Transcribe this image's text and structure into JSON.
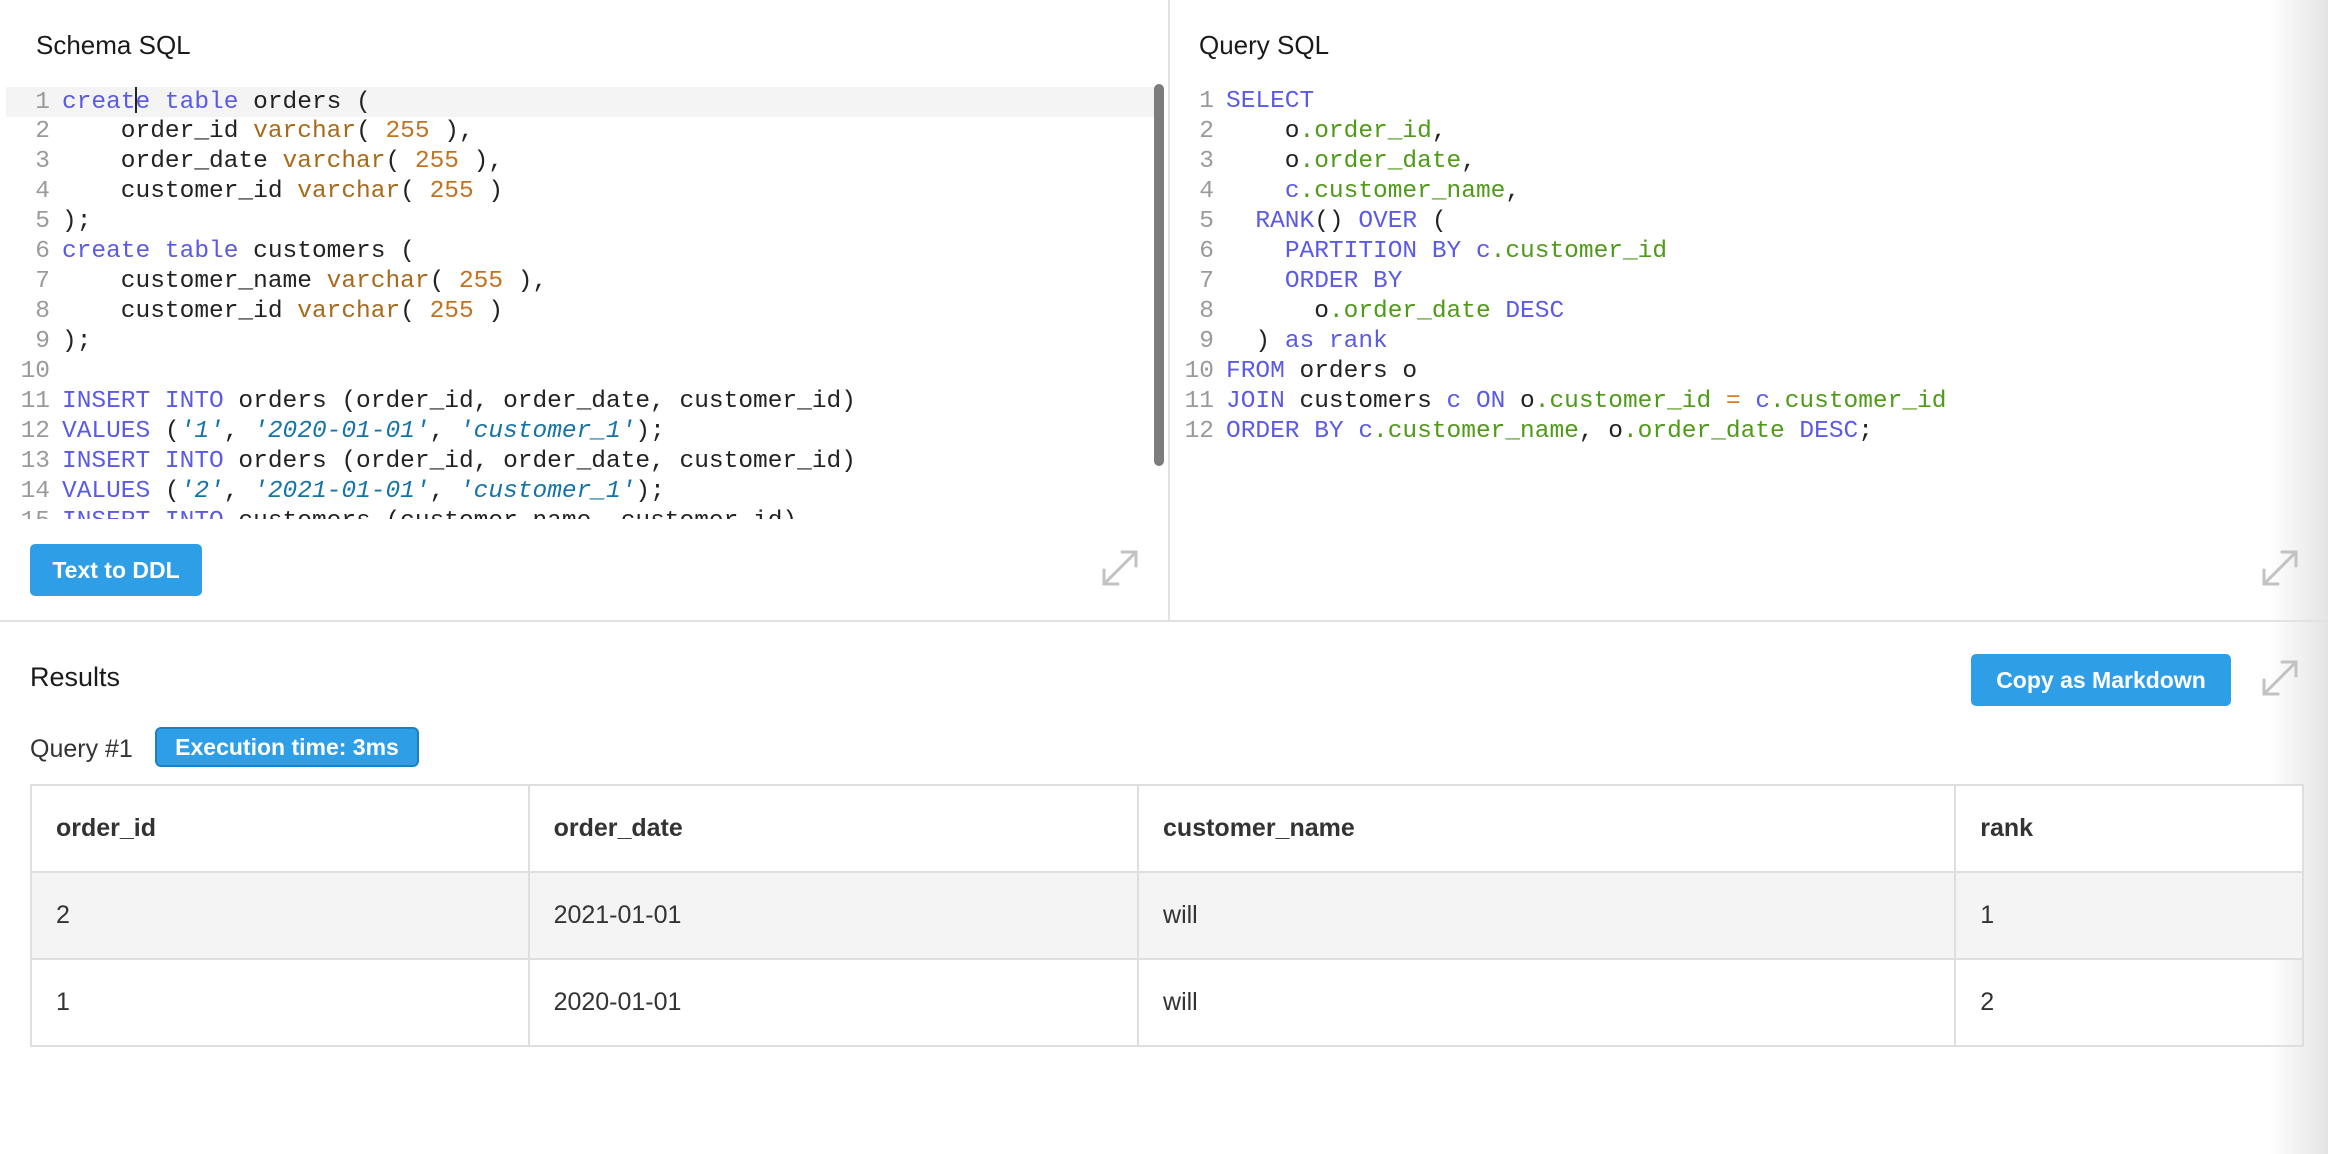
{
  "schema_panel": {
    "title": "Schema SQL",
    "button_label": "Text to DDL",
    "lines": [
      {
        "n": "1",
        "tokens": [
          [
            "kw",
            "creat"
          ],
          [
            "cursor",
            ""
          ],
          [
            "kw",
            "e"
          ],
          [
            "txt",
            " "
          ],
          [
            "kw",
            "table"
          ],
          [
            "txt",
            " orders ("
          ]
        ]
      },
      {
        "n": "2",
        "tokens": [
          [
            "txt",
            "    order_id "
          ],
          [
            "fn",
            "varchar"
          ],
          [
            "txt",
            "( "
          ],
          [
            "num",
            "255"
          ],
          [
            "txt",
            " ),"
          ]
        ]
      },
      {
        "n": "3",
        "tokens": [
          [
            "txt",
            "    order_date "
          ],
          [
            "fn",
            "varchar"
          ],
          [
            "txt",
            "( "
          ],
          [
            "num",
            "255"
          ],
          [
            "txt",
            " ),"
          ]
        ]
      },
      {
        "n": "4",
        "tokens": [
          [
            "txt",
            "    customer_id "
          ],
          [
            "fn",
            "varchar"
          ],
          [
            "txt",
            "( "
          ],
          [
            "num",
            "255"
          ],
          [
            "txt",
            " )"
          ]
        ]
      },
      {
        "n": "5",
        "tokens": [
          [
            "txt",
            ");"
          ]
        ]
      },
      {
        "n": "6",
        "tokens": [
          [
            "kw",
            "create"
          ],
          [
            "txt",
            " "
          ],
          [
            "kw",
            "table"
          ],
          [
            "txt",
            " customers ("
          ]
        ]
      },
      {
        "n": "7",
        "tokens": [
          [
            "txt",
            "    customer_name "
          ],
          [
            "fn",
            "varchar"
          ],
          [
            "txt",
            "( "
          ],
          [
            "num",
            "255"
          ],
          [
            "txt",
            " ),"
          ]
        ]
      },
      {
        "n": "8",
        "tokens": [
          [
            "txt",
            "    customer_id "
          ],
          [
            "fn",
            "varchar"
          ],
          [
            "txt",
            "( "
          ],
          [
            "num",
            "255"
          ],
          [
            "txt",
            " )"
          ]
        ]
      },
      {
        "n": "9",
        "tokens": [
          [
            "txt",
            ");"
          ]
        ]
      },
      {
        "n": "10",
        "tokens": []
      },
      {
        "n": "11",
        "tokens": [
          [
            "kw",
            "INSERT"
          ],
          [
            "txt",
            " "
          ],
          [
            "kw",
            "INTO"
          ],
          [
            "txt",
            " orders (order_id, order_date, customer_id)"
          ]
        ]
      },
      {
        "n": "12",
        "tokens": [
          [
            "kw",
            "VALUES"
          ],
          [
            "txt",
            " ("
          ],
          [
            "str",
            "'1'"
          ],
          [
            "txt",
            ", "
          ],
          [
            "str",
            "'2020-01-01'"
          ],
          [
            "txt",
            ", "
          ],
          [
            "str",
            "'customer_1'"
          ],
          [
            "txt",
            ");"
          ]
        ]
      },
      {
        "n": "13",
        "tokens": [
          [
            "kw",
            "INSERT"
          ],
          [
            "txt",
            " "
          ],
          [
            "kw",
            "INTO"
          ],
          [
            "txt",
            " orders (order_id, order_date, customer_id)"
          ]
        ]
      },
      {
        "n": "14",
        "tokens": [
          [
            "kw",
            "VALUES"
          ],
          [
            "txt",
            " ("
          ],
          [
            "str",
            "'2'"
          ],
          [
            "txt",
            ", "
          ],
          [
            "str",
            "'2021-01-01'"
          ],
          [
            "txt",
            ", "
          ],
          [
            "str",
            "'customer_1'"
          ],
          [
            "txt",
            ");"
          ]
        ]
      },
      {
        "n": "15",
        "tokens": [
          [
            "kw",
            "INSERT"
          ],
          [
            "txt",
            " "
          ],
          [
            "kw",
            "INTO"
          ],
          [
            "txt",
            " customers (customer_name, customer_id)"
          ]
        ]
      }
    ]
  },
  "query_panel": {
    "title": "Query SQL",
    "lines": [
      {
        "n": "1",
        "tokens": [
          [
            "kw",
            "SELECT"
          ]
        ]
      },
      {
        "n": "2",
        "tokens": [
          [
            "txt",
            "    o"
          ],
          [
            "prop",
            ".order_id"
          ],
          [
            "txt",
            ","
          ]
        ]
      },
      {
        "n": "3",
        "tokens": [
          [
            "txt",
            "    o"
          ],
          [
            "prop",
            ".order_date"
          ],
          [
            "txt",
            ","
          ]
        ]
      },
      {
        "n": "4",
        "tokens": [
          [
            "txt",
            "    "
          ],
          [
            "kw",
            "c"
          ],
          [
            "prop",
            ".customer_name"
          ],
          [
            "txt",
            ","
          ]
        ]
      },
      {
        "n": "5",
        "tokens": [
          [
            "txt",
            "  "
          ],
          [
            "kw",
            "RANK"
          ],
          [
            "txt",
            "() "
          ],
          [
            "kw",
            "OVER"
          ],
          [
            "txt",
            " ("
          ]
        ]
      },
      {
        "n": "6",
        "tokens": [
          [
            "txt",
            "    "
          ],
          [
            "kw",
            "PARTITION BY"
          ],
          [
            "txt",
            " "
          ],
          [
            "kw",
            "c"
          ],
          [
            "prop",
            ".customer_id"
          ]
        ]
      },
      {
        "n": "7",
        "tokens": [
          [
            "txt",
            "    "
          ],
          [
            "kw",
            "ORDER BY"
          ]
        ]
      },
      {
        "n": "8",
        "tokens": [
          [
            "txt",
            "      o"
          ],
          [
            "prop",
            ".order_date"
          ],
          [
            "txt",
            " "
          ],
          [
            "kw",
            "DESC"
          ]
        ]
      },
      {
        "n": "9",
        "tokens": [
          [
            "txt",
            "  ) "
          ],
          [
            "kw",
            "as"
          ],
          [
            "txt",
            " "
          ],
          [
            "kw",
            "rank"
          ]
        ]
      },
      {
        "n": "10",
        "tokens": [
          [
            "kw",
            "FROM"
          ],
          [
            "txt",
            " orders o"
          ]
        ]
      },
      {
        "n": "11",
        "tokens": [
          [
            "kw",
            "JOIN"
          ],
          [
            "txt",
            " customers "
          ],
          [
            "kw",
            "c"
          ],
          [
            "txt",
            " "
          ],
          [
            "kw",
            "ON"
          ],
          [
            "txt",
            " o"
          ],
          [
            "prop",
            ".customer_id"
          ],
          [
            "txt",
            " "
          ],
          [
            "op",
            "="
          ],
          [
            "txt",
            " "
          ],
          [
            "kw",
            "c"
          ],
          [
            "prop",
            ".customer_id"
          ]
        ]
      },
      {
        "n": "12",
        "tokens": [
          [
            "kw",
            "ORDER BY"
          ],
          [
            "txt",
            " "
          ],
          [
            "kw",
            "c"
          ],
          [
            "prop",
            ".customer_name"
          ],
          [
            "txt",
            ", o"
          ],
          [
            "prop",
            ".order_date"
          ],
          [
            "txt",
            " "
          ],
          [
            "kw",
            "DESC"
          ],
          [
            "txt",
            ";"
          ]
        ]
      }
    ]
  },
  "results": {
    "title": "Results",
    "copy_button_label": "Copy as Markdown",
    "query_label": "Query #1",
    "execution_badge": "Execution time: 3ms",
    "columns": [
      "order_id",
      "order_date",
      "customer_name",
      "rank"
    ],
    "rows": [
      [
        "2",
        "2021-01-01",
        "will",
        "1"
      ],
      [
        "1",
        "2020-01-01",
        "will",
        "2"
      ]
    ]
  },
  "icons": {
    "expand": "expand-icon"
  },
  "colors": {
    "accent": "#2e9fe6",
    "keyword": "#5a5ae6",
    "number": "#c4721f",
    "string": "#1473a8",
    "property": "#4f9a18"
  }
}
